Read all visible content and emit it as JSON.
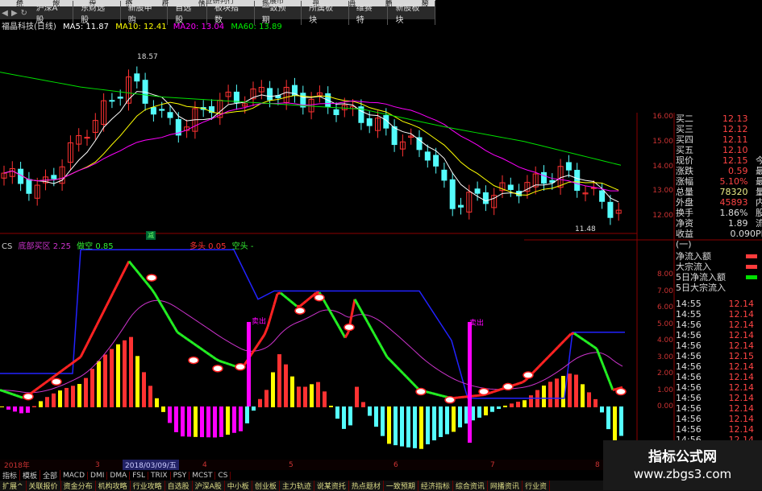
{
  "menu": [
    "系统",
    "功能",
    "工程",
    "报价",
    "分析",
    "专业研判行情",
    "扩展市场",
    "资讯",
    "工具",
    "帮助",
    "炒股"
  ],
  "tabs": [
    "沪深A股",
    "东财选股",
    "新股申购",
    "自选股",
    "板块指数",
    "一致预期",
    "所属板块",
    "维赛特",
    "新股板块"
  ],
  "title": {
    "stock": "福晶科技(日线)",
    "ma5": "MA5: 11.87",
    "ma10": "MA10: 12.41",
    "ma20": "MA20: 13.04",
    "ma60": "MA60: 13.89"
  },
  "colors": {
    "up": "#ff3232",
    "down": "#54fcfc",
    "ma5": "#ffffff",
    "ma10": "#ffff00",
    "ma20": "#ff00ff",
    "ma60": "#00e000",
    "grid": "#8b0000"
  },
  "price_axis": [
    "16.00",
    "15.00",
    "14.00",
    "13.00",
    "12.00"
  ],
  "ind_axis": [
    "8.00",
    "7.00",
    "6.00",
    "5.00",
    "4.00",
    "3.00",
    "2.00",
    "1.00",
    "0.00"
  ],
  "annotations": {
    "high": "18.57",
    "low": "11.48",
    "sell1": "卖出",
    "sell2": "卖出",
    "marker": "减"
  },
  "quotes": [
    {
      "label": "买二",
      "value": "12.13",
      "extra": ""
    },
    {
      "label": "买三",
      "value": "12.12",
      "extra": ""
    },
    {
      "label": "买四",
      "value": "12.11",
      "extra": ""
    },
    {
      "label": "买五",
      "value": "12.10",
      "extra": ""
    },
    {
      "label": "现价",
      "value": "12.15",
      "extra": "今"
    },
    {
      "label": "涨跌",
      "value": "0.59",
      "extra": "最"
    },
    {
      "label": "涨幅",
      "value": "5.10%",
      "extra": "最"
    },
    {
      "label": "总量",
      "value": "78320",
      "extra": "量"
    },
    {
      "label": "外盘",
      "value": "45893",
      "extra": "内"
    },
    {
      "label": "换手",
      "value": "1.86%",
      "extra": "股"
    },
    {
      "label": "净资",
      "value": "1.89",
      "extra": "流"
    },
    {
      "label": "收益(一)",
      "value": "0.090",
      "extra": "PE"
    }
  ],
  "flow_legend": [
    {
      "label": "净流入额",
      "color": "#ff3c3c"
    },
    {
      "label": "大宗流入",
      "color": "#ff3c3c"
    },
    {
      "label": "5日净流入额",
      "color": "#00e000"
    },
    {
      "label": "5日大宗流入",
      "color": ""
    }
  ],
  "ticks": [
    [
      "14:55",
      "12.14"
    ],
    [
      "14:55",
      "12.14"
    ],
    [
      "14:56",
      "12.14"
    ],
    [
      "14:56",
      "12.14"
    ],
    [
      "14:56",
      "12.14"
    ],
    [
      "14:56",
      "12.15"
    ],
    [
      "14:56",
      "12.14"
    ],
    [
      "14:56",
      "12.14"
    ],
    [
      "14:56",
      "12.14"
    ],
    [
      "14:56",
      "12.14"
    ],
    [
      "14:56",
      "12.14"
    ],
    [
      "14:56",
      "12.14"
    ],
    [
      "14:56",
      "12.14"
    ],
    [
      "14:56",
      "12.14"
    ]
  ],
  "legend": {
    "name": "CS",
    "a": "底部买区 2.25",
    "b": "做空 0.85",
    "c": "多头 0.05",
    "d": "空头 -"
  },
  "date_axis": [
    "2018年",
    "3",
    "2018/03/09/五",
    "4",
    "5",
    "6",
    "7",
    "8"
  ],
  "indicator_tabs": [
    "指标",
    "模板",
    "全部",
    "MACD",
    "DMI",
    "DMA",
    "FSL",
    "TRIX",
    "PSY",
    "MCST",
    "CS"
  ],
  "bottom_tabs": [
    "扩展^",
    "关联报价",
    "资金分布",
    "机构攻略",
    "行业攻略",
    "自选股",
    "沪深A股",
    "中小板",
    "创业板",
    "主力轨迹",
    "说某资托",
    "热点题材",
    "一致预期",
    "经济指标",
    "综合资讯",
    "网播资讯",
    "行业资"
  ],
  "watermark": {
    "name": "指标公式网",
    "url": "www.zbgs3.com"
  },
  "chart_data": {
    "type": "candlestick",
    "close_keypoints": [
      [
        0,
        13.8
      ],
      [
        50,
        13.0
      ],
      [
        100,
        15.2
      ],
      [
        160,
        17.5
      ],
      [
        200,
        16.0
      ],
      [
        225,
        15.5
      ],
      [
        260,
        16.5
      ],
      [
        330,
        17.0
      ],
      [
        400,
        16.6
      ],
      [
        450,
        16.0
      ],
      [
        500,
        15.0
      ],
      [
        530,
        14.6
      ],
      [
        560,
        12.5
      ],
      [
        600,
        12.8
      ],
      [
        650,
        13.2
      ],
      [
        700,
        13.8
      ],
      [
        720,
        13.2
      ],
      [
        760,
        12.2
      ],
      [
        775,
        12.15
      ]
    ],
    "ma60_keypoints": [
      [
        0,
        17.8
      ],
      [
        100,
        17.2
      ],
      [
        200,
        16.8
      ],
      [
        300,
        16.6
      ],
      [
        450,
        16.3
      ],
      [
        550,
        15.6
      ],
      [
        650,
        15.0
      ],
      [
        775,
        14.0
      ]
    ],
    "cs_keypoints": [
      [
        0,
        1
      ],
      [
        30,
        0.5
      ],
      [
        100,
        3
      ],
      [
        160,
        8.8
      ],
      [
        190,
        7
      ],
      [
        220,
        4.5
      ],
      [
        270,
        2.8
      ],
      [
        300,
        2.3
      ],
      [
        330,
        4.5
      ],
      [
        345,
        7
      ],
      [
        370,
        6
      ],
      [
        395,
        7
      ],
      [
        430,
        4
      ],
      [
        440,
        6.5
      ],
      [
        480,
        3
      ],
      [
        520,
        1
      ],
      [
        560,
        0.5
      ],
      [
        600,
        0.7
      ],
      [
        650,
        1.5
      ],
      [
        710,
        4.5
      ],
      [
        740,
        3.5
      ],
      [
        760,
        1
      ],
      [
        775,
        1.2
      ]
    ],
    "step_keypoints": [
      [
        0,
        2
      ],
      [
        90,
        2
      ],
      [
        100,
        9.5
      ],
      [
        290,
        9.5
      ],
      [
        320,
        6.5
      ],
      [
        340,
        7
      ],
      [
        520,
        7
      ],
      [
        560,
        4
      ],
      [
        580,
        0.5
      ],
      [
        700,
        0.5
      ],
      [
        710,
        4.5
      ],
      [
        775,
        4.5
      ]
    ]
  }
}
